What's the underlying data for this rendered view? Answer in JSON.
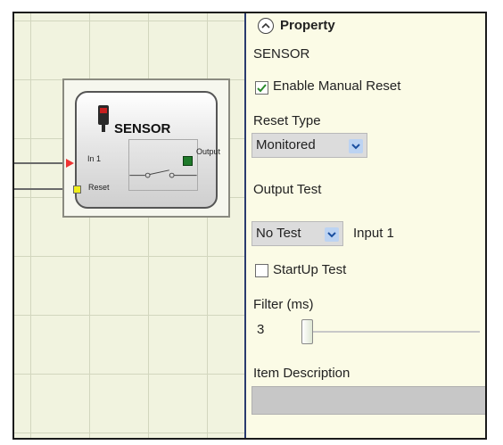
{
  "component": {
    "title": "SENSOR",
    "port_in1": "In 1",
    "port_reset": "Reset",
    "port_output": "Output"
  },
  "panel": {
    "header_title": "Property",
    "component_name": "SENSOR",
    "enable_manual_reset": {
      "label": "Enable Manual Reset",
      "checked": true
    },
    "reset_type": {
      "label": "Reset Type",
      "selected": "Monitored"
    },
    "output_test": {
      "label": "Output Test",
      "selected": "No Test",
      "input_label": "Input 1"
    },
    "startup_test": {
      "label": "StartUp Test",
      "checked": false
    },
    "filter": {
      "label": "Filter (ms)",
      "value": "3",
      "slider_fraction": 0.0
    },
    "item_description": {
      "label": "Item Description",
      "value": ""
    }
  },
  "icons": [
    "collapse-up-icon",
    "chevron-down-icon",
    "sensor-icon",
    "switch-contact-icon"
  ],
  "colors": {
    "accent_blue": "#bcd3f2",
    "checkmark_green": "#2a8a2a",
    "output_green": "#1f7a2a",
    "input_red": "#e33333",
    "reset_yellow": "#f0ee1a"
  }
}
